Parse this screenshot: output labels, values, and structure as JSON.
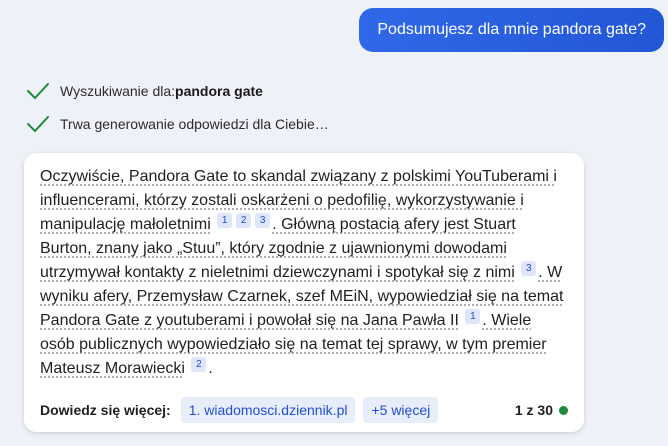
{
  "user_message": "Podsumujesz dla mnie pandora gate?",
  "steps": [
    {
      "label": "Wyszukiwanie dla: ",
      "query": "pandora gate"
    },
    {
      "label": "Trwa generowanie odpowiedzi dla Ciebie…"
    }
  ],
  "answer": {
    "p1": "Oczywiście, Pandora Gate to skandal związany z polskimi YouTuberami i influencerami, którzy zostali oskarżeni o pedofilię, wykorzystywanie i manipulację małoletnimi",
    "p1_cites": [
      "1",
      "2",
      "3"
    ],
    "p2": ". Główną postacią afery jest Stuart Burton, znany jako „Stuu”, który zgodnie z ujawnionymi dowodami utrzymywał kontakty z nieletnimi dziewczynami i spotykał się z nimi",
    "p2_cites": [
      "3"
    ],
    "p3": ". W wyniku afery, Przemysław Czarnek, szef MEiN, wypowiedział się na temat Pandora Gate z youtuberami i powołał się na Jana Pawła II",
    "p3_cites": [
      "1"
    ],
    "p4": ". Wiele osób publicznych wypowiedziało się na temat tej sprawy, w tym premier Mateusz Morawiecki",
    "p4_cites": [
      "2"
    ],
    "end": "."
  },
  "footer": {
    "learn_more": "Dowiedz się więcej:",
    "sources": [
      "1. wiadomosci.dziennik.pl"
    ],
    "more": "+5 więcej",
    "count": "1 z 30"
  },
  "colors": {
    "accent": "#2257d6",
    "check": "#1c8a3a",
    "status_dot": "#1c8a3a"
  },
  "icons": {
    "step_done": "check-icon"
  }
}
